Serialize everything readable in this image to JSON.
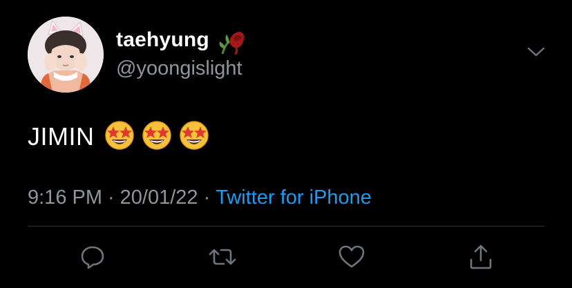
{
  "user": {
    "display_name": "taehyung",
    "name_emoji": "wilted-rose-emoji",
    "handle": "@yoongislight",
    "avatar": "profile-photo"
  },
  "tweet": {
    "text": "JIMIN",
    "emojis": [
      "star-struck-emoji",
      "star-struck-emoji",
      "star-struck-emoji"
    ]
  },
  "meta": {
    "time": "9:16 PM",
    "separator": "·",
    "date": "20/01/22",
    "source": "Twitter for iPhone"
  },
  "actions": [
    "reply-icon",
    "retweet-icon",
    "like-icon",
    "share-icon"
  ],
  "colors": {
    "background": "#000000",
    "text": "#ffffff",
    "secondary": "#8f969c",
    "link": "#1d9bf0",
    "divider": "#2f3336"
  }
}
